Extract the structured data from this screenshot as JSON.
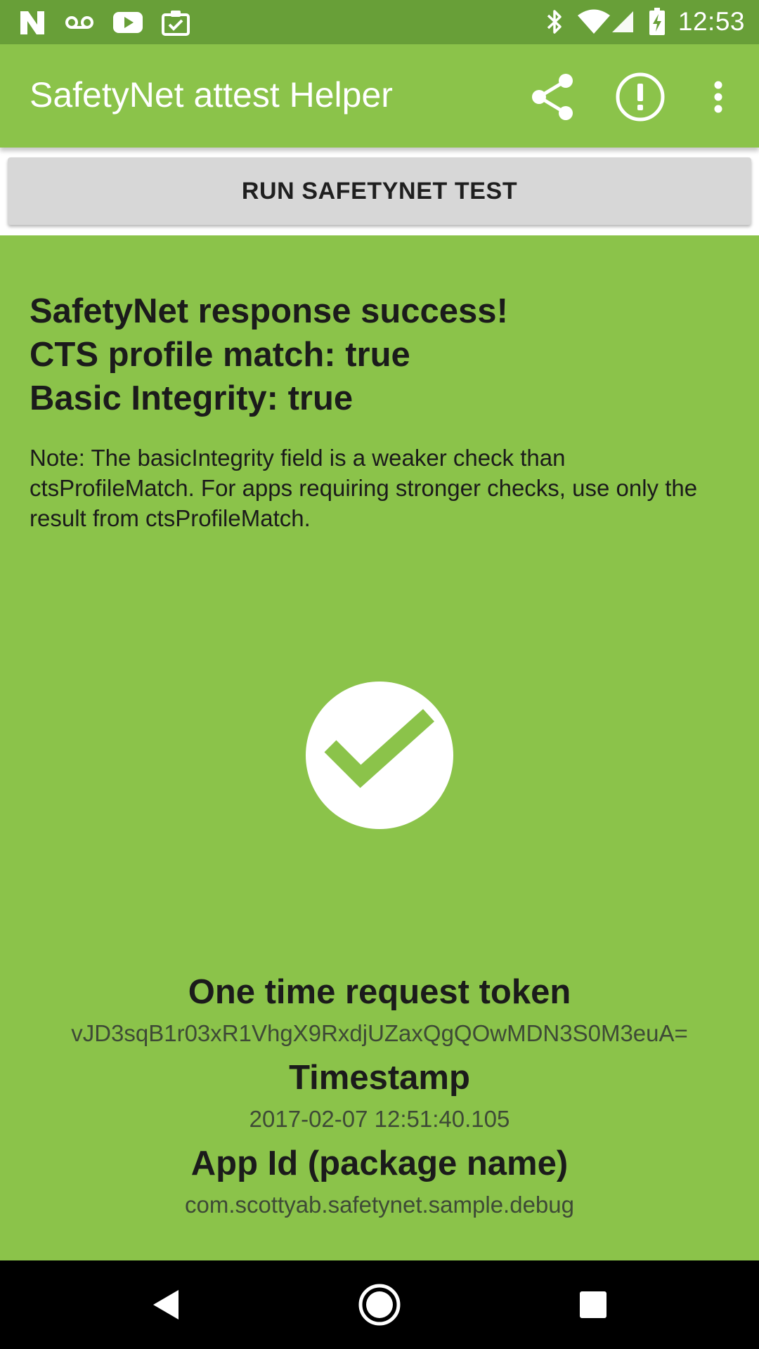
{
  "status_bar": {
    "time": "12:53",
    "left_icons": [
      "n-notification-icon",
      "voicemail-icon",
      "youtube-icon",
      "clipboard-check-icon"
    ],
    "right_icons": [
      "bluetooth-icon",
      "wifi-icon",
      "cell-signal-icon",
      "battery-charging-icon"
    ]
  },
  "app_bar": {
    "title": "SafetyNet attest Helper",
    "actions": [
      "share-icon",
      "alert-circle-icon",
      "overflow-menu-icon"
    ]
  },
  "run_button": {
    "label": "RUN SAFETYNET TEST"
  },
  "result": {
    "line1": "SafetyNet response success!",
    "line2": "CTS profile match: true",
    "line3": "Basic Integrity: true",
    "note": "Note: The basicIntegrity field is a weaker check than ctsProfileMatch. For apps requiring stronger checks, use only the result from ctsProfileMatch.",
    "status_icon": "check-circle-icon"
  },
  "details": {
    "token_label": "One time request token",
    "token_value": "vJD3sqB1r03xR1VhgX9RxdjUZaxQgQOwMDN3S0M3euA=",
    "timestamp_label": "Timestamp",
    "timestamp_value": "2017-02-07 12:51:40.105",
    "appid_label": "App Id (package name)",
    "appid_value": "com.scottyab.safetynet.sample.debug"
  },
  "nav_bar": {
    "buttons": [
      "back-icon",
      "home-icon",
      "recents-icon"
    ]
  },
  "colors": {
    "primary": "#8bc34a",
    "primary_dark": "#689f38",
    "button": "#d7d7d7",
    "text": "#1b1b1b"
  }
}
